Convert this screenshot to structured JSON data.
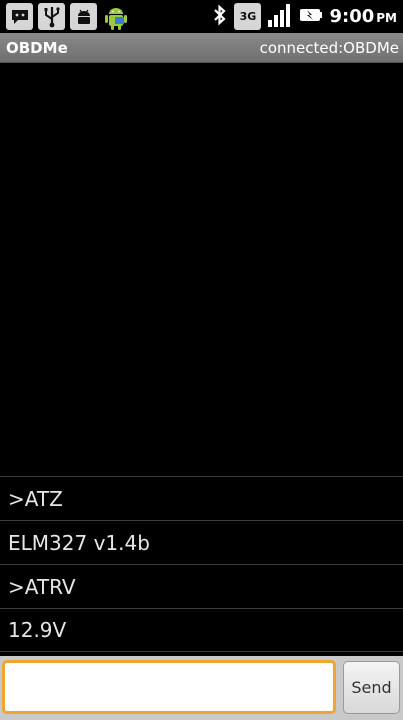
{
  "status_bar": {
    "time": "9:00",
    "ampm": "PM",
    "icons": [
      "message-icon",
      "usb-icon",
      "debug-icon",
      "android-icon",
      "bluetooth-icon",
      "3g-icon",
      "signal-icon",
      "battery-icon"
    ],
    "label_3g": "3G"
  },
  "title_bar": {
    "app_title": "OBDMe",
    "connection_status": "connected:OBDMe"
  },
  "log": {
    "rows": [
      ">ATZ",
      "ELM327 v1.4b",
      ">ATRV",
      "12.9V"
    ]
  },
  "input": {
    "value": "",
    "placeholder": ""
  },
  "send_label": "Send",
  "colors": {
    "title_bar": "#7d7d7d",
    "input_border": "#f0a530",
    "background": "#000000"
  }
}
